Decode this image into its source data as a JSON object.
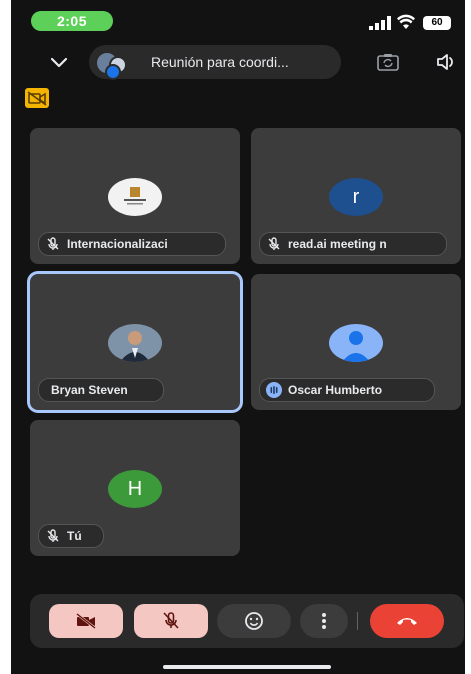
{
  "status_bar": {
    "time": "2:05",
    "battery": "60"
  },
  "header": {
    "meeting_title": "Reunión para coordi..."
  },
  "participants": [
    {
      "name": "Internacionalizaci",
      "muted": true,
      "avatar": "logo",
      "speaking": false
    },
    {
      "name": "read.ai meeting n",
      "muted": true,
      "avatar_letter": "r",
      "avatar_color": "#1e4f8f",
      "speaking": false
    },
    {
      "name": "Bryan Steven",
      "muted": false,
      "avatar": "photo",
      "speaking": true
    },
    {
      "name": "Oscar Humberto",
      "muted": false,
      "avatar": "generic-person",
      "avatar_color": "#8ab4f8",
      "speaking": false
    },
    {
      "name": "Tú",
      "muted": true,
      "avatar_letter": "H",
      "avatar_color": "#3c9a3a",
      "speaking": false
    }
  ],
  "controls": {
    "camera": "off",
    "microphone": "off"
  },
  "colors": {
    "background": "#121212",
    "tile": "#3c3c3c",
    "active_border": "#a8c7fa",
    "off_button": "#f4c7c3",
    "end_call": "#ea4335",
    "status_green": "#5dd05a",
    "badge_yellow": "#f5b400"
  }
}
